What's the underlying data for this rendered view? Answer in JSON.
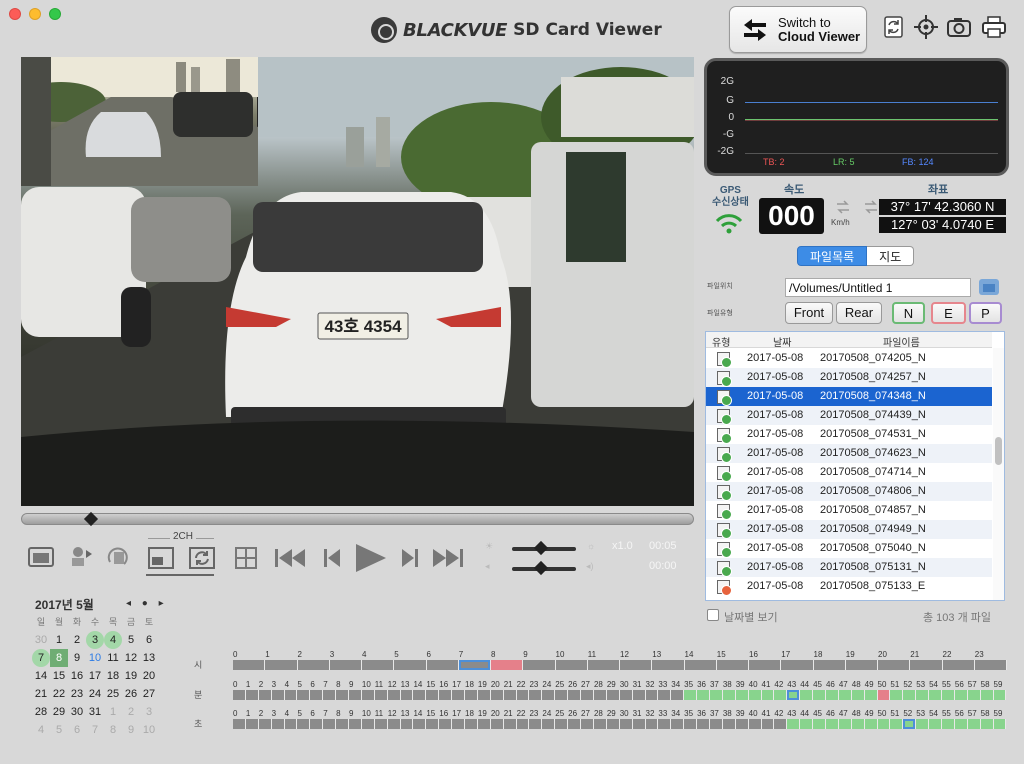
{
  "window": {
    "title_brand": "BLACKVUE",
    "title_sub": "SD Card Viewer"
  },
  "cloud_button": {
    "line1": "Switch to",
    "line2": "Cloud Viewer"
  },
  "toolbar_icons": [
    "refresh-icon",
    "gps-target-icon",
    "camera-icon",
    "printer-icon"
  ],
  "video": {
    "plate": "43호 4354"
  },
  "controls": {
    "twoch": "2CH",
    "speed": "x1.0",
    "time_current": "00:05",
    "time_total": "00:00"
  },
  "calendar": {
    "title": "2017년 5월",
    "nav": "◂ ● ▸",
    "weekdays": [
      "일",
      "월",
      "화",
      "수",
      "목",
      "금",
      "토"
    ],
    "rows": [
      [
        "30",
        "1",
        "2",
        "3",
        "4",
        "5",
        "6"
      ],
      [
        "7",
        "8",
        "9",
        "10",
        "11",
        "12",
        "13"
      ],
      [
        "14",
        "15",
        "16",
        "17",
        "18",
        "19",
        "20"
      ],
      [
        "21",
        "22",
        "23",
        "24",
        "25",
        "26",
        "27"
      ],
      [
        "28",
        "29",
        "30",
        "31",
        "1",
        "2",
        "3"
      ],
      [
        "4",
        "5",
        "6",
        "7",
        "8",
        "9",
        "10"
      ]
    ]
  },
  "timeline": {
    "side_labels": [
      "시",
      "분",
      "초"
    ]
  },
  "gsensor": {
    "labels": [
      "2G",
      "G",
      "0",
      "-G",
      "-2G"
    ],
    "tb": "TB: 2",
    "lr": "LR: 5",
    "fb": "FB: 124"
  },
  "gps": {
    "label_line1": "GPS",
    "label_line2": "수신상태",
    "speed_label": "속도",
    "speed": "000",
    "speed_unit": "Km/h",
    "coord_label": "좌표",
    "lat": "37° 17' 42.3060 N",
    "lon": "127° 03' 4.0740 E"
  },
  "panel": {
    "tabs": [
      "파일목록",
      "지도"
    ],
    "path_label": "파일위치",
    "path": "/Volumes/Untitled 1",
    "type_label": "파일유형",
    "types": [
      "Front",
      "Rear",
      "N",
      "E",
      "P"
    ]
  },
  "files": {
    "headers": [
      "유형",
      "날짜",
      "파일이름"
    ],
    "rows": [
      {
        "date": "2017-05-08",
        "name": "20170508_074205_N",
        "kind": "N"
      },
      {
        "date": "2017-05-08",
        "name": "20170508_074257_N",
        "kind": "N"
      },
      {
        "date": "2017-05-08",
        "name": "20170508_074348_N",
        "kind": "N"
      },
      {
        "date": "2017-05-08",
        "name": "20170508_074439_N",
        "kind": "N"
      },
      {
        "date": "2017-05-08",
        "name": "20170508_074531_N",
        "kind": "N"
      },
      {
        "date": "2017-05-08",
        "name": "20170508_074623_N",
        "kind": "N"
      },
      {
        "date": "2017-05-08",
        "name": "20170508_074714_N",
        "kind": "N"
      },
      {
        "date": "2017-05-08",
        "name": "20170508_074806_N",
        "kind": "N"
      },
      {
        "date": "2017-05-08",
        "name": "20170508_074857_N",
        "kind": "N"
      },
      {
        "date": "2017-05-08",
        "name": "20170508_074949_N",
        "kind": "N"
      },
      {
        "date": "2017-05-08",
        "name": "20170508_075040_N",
        "kind": "N"
      },
      {
        "date": "2017-05-08",
        "name": "20170508_075131_N",
        "kind": "N"
      },
      {
        "date": "2017-05-08",
        "name": "20170508_075133_E",
        "kind": "E"
      }
    ],
    "date_view_label": "날짜별 보기",
    "count": "총 103 개 파일"
  },
  "colors": {
    "accent": "#1b64d0",
    "event_green": "#88d48d",
    "event_red": "#e5808a"
  }
}
